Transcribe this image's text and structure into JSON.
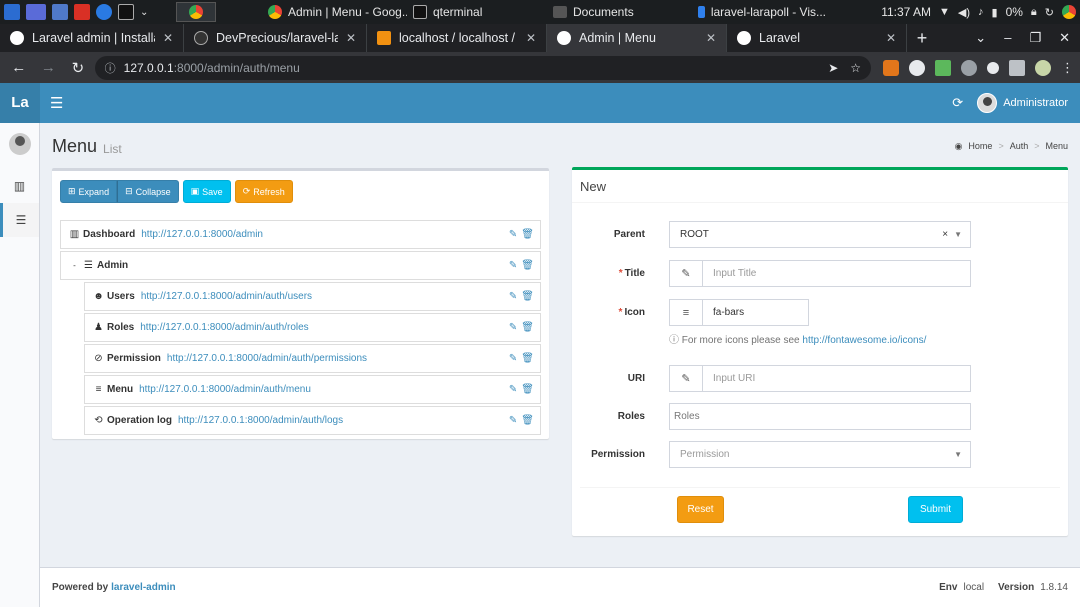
{
  "taskbar": {
    "tasks": [
      {
        "label": "Admin | Menu - Goog..."
      },
      {
        "label": "qterminal"
      },
      {
        "label": "Documents"
      },
      {
        "label": "laravel-larapoll - Vis..."
      }
    ],
    "time": "11:37 AM",
    "battery": "0%"
  },
  "browser": {
    "tabs": [
      {
        "title": "Laravel admin | Installati"
      },
      {
        "title": "DevPrecious/laravel-lar"
      },
      {
        "title": "localhost / localhost / pc"
      },
      {
        "title": "Admin | Menu"
      },
      {
        "title": "Laravel"
      }
    ],
    "url_host": "127.0.0.1",
    "url_path": ":8000/admin/auth/menu"
  },
  "header": {
    "logo": "La",
    "user_name": "Administrator"
  },
  "content": {
    "title": "Menu",
    "subtitle": "List",
    "breadcrumb": {
      "home": "Home",
      "auth": "Auth",
      "menu": "Menu"
    }
  },
  "toolbar": {
    "expand": "Expand",
    "collapse": "Collapse",
    "save": "Save",
    "refresh": "Refresh"
  },
  "menu_tree": [
    {
      "name": "Dashboard",
      "url": "http://127.0.0.1:8000/admin",
      "icon": "bar-chart-icon"
    },
    {
      "name": "Admin",
      "url": "",
      "icon": "tasks-icon"
    },
    {
      "name": "Users",
      "url": "http://127.0.0.1:8000/admin/auth/users",
      "icon": "users-icon"
    },
    {
      "name": "Roles",
      "url": "http://127.0.0.1:8000/admin/auth/roles",
      "icon": "user-icon"
    },
    {
      "name": "Permission",
      "url": "http://127.0.0.1:8000/admin/auth/permissions",
      "icon": "ban-icon"
    },
    {
      "name": "Menu",
      "url": "http://127.0.0.1:8000/admin/auth/menu",
      "icon": "bars-icon"
    },
    {
      "name": "Operation log",
      "url": "http://127.0.0.1:8000/admin/auth/logs",
      "icon": "history-icon"
    }
  ],
  "form": {
    "title": "New",
    "parent_label": "Parent",
    "parent_value": "ROOT",
    "title_label": "Title",
    "title_placeholder": "Input Title",
    "icon_label": "Icon",
    "icon_value": "fa-bars",
    "icon_help": "For more icons please see ",
    "icon_help_link": "http://fontawesome.io/icons/",
    "uri_label": "URI",
    "uri_placeholder": "Input URI",
    "roles_label": "Roles",
    "roles_placeholder": "Roles",
    "permission_label": "Permission",
    "permission_placeholder": "Permission",
    "reset": "Reset",
    "submit": "Submit"
  },
  "footer": {
    "powered_by": "Powered by",
    "powered_link": "laravel-admin",
    "env_label": "Env",
    "env_value": "local",
    "version_label": "Version",
    "version_value": "1.8.14"
  },
  "colors": {
    "header": "#3c8dbc",
    "success": "#00a65a",
    "info": "#00c0ef",
    "warning": "#f39c12"
  }
}
